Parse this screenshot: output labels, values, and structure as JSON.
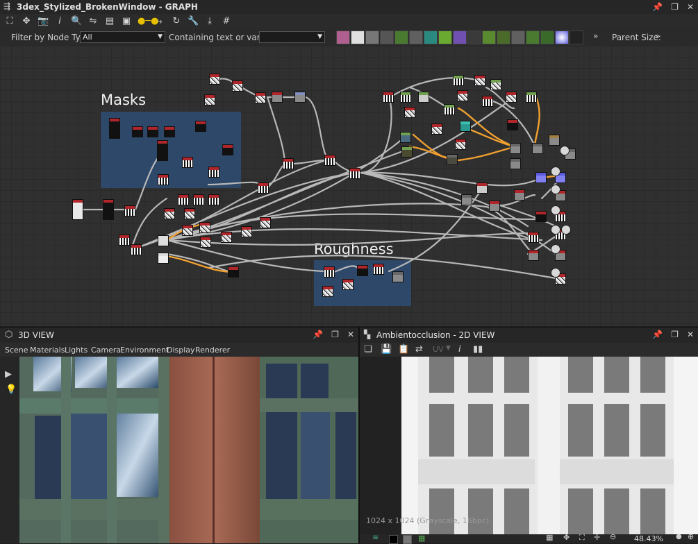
{
  "graph_window": {
    "title": "3dex_Stylized_BrokenWindow - GRAPH",
    "filter_label": "Filter by Node Type",
    "filter_value": "All",
    "text_filter_label": "Containing text or variable",
    "text_filter_value": "",
    "parent_size_label": "Parent Size:",
    "frames": [
      {
        "title": "Masks"
      },
      {
        "title": "Roughness"
      }
    ]
  },
  "panel_3d": {
    "title": "3D VIEW",
    "menu": [
      "Scene",
      "Materials",
      "Lights",
      "Camera",
      "Environment",
      "Display",
      "Renderer"
    ]
  },
  "panel_2d": {
    "title": "Ambientocclusion - 2D VIEW",
    "uv_label": "UV",
    "resolution_text": "1024 x 1024 (Grayscale, 16bpc)",
    "zoom": "48.43%"
  },
  "icons": {
    "graph_menu": "graph-icon",
    "pin": "pin-icon",
    "restore": "restore-icon",
    "close": "close-icon"
  },
  "colors": {
    "frame_blue": "#2e4a6e",
    "link_orange": "#f0a030",
    "link_gray": "#b8b8b8",
    "node_header_red": "#b0262a"
  }
}
